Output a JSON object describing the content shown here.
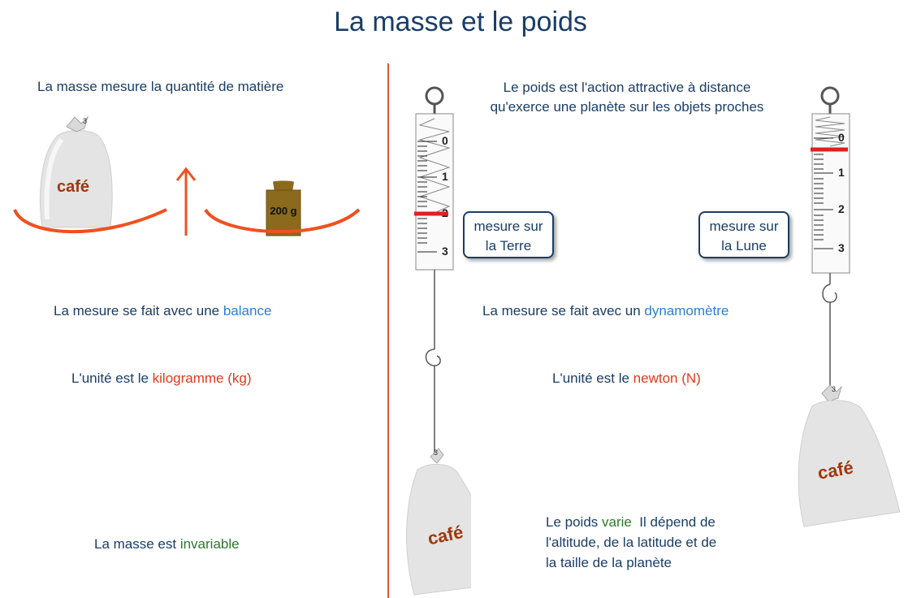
{
  "title": "La masse et le poids",
  "left": {
    "definition": "La masse mesure la quantité de matière",
    "instrument_prefix": "La mesure se fait avec une ",
    "instrument": "balance",
    "unit_prefix": "L'unité est le ",
    "unit": "kilogramme (kg)",
    "invariance_prefix": "La masse est ",
    "invariance": "invariable",
    "bag_label": "café",
    "weight_label": "200 g"
  },
  "right": {
    "definition_line1": "Le poids est l'action attractive à distance",
    "definition_line2": "qu'exerce une planète sur les objets proches",
    "instrument_prefix": "La mesure se fait avec un ",
    "instrument": "dynamomètre",
    "unit_prefix": "L'unité est le ",
    "unit": "newton (N)",
    "varies_prefix": "Le poids ",
    "varies_word": "varie",
    "varies_line1_rest": "  Il dépend de",
    "varies_line2": "l'altitude, de la latitude et de",
    "varies_line3": "la taille de la planète",
    "callout_earth": "mesure sur\nla Terre",
    "callout_moon": "mesure sur\nla Lune",
    "scale_ticks": [
      "0",
      "1",
      "2",
      "3"
    ],
    "bag_label": "café",
    "earth_reading": 2,
    "moon_reading": 0.3
  },
  "colors": {
    "title": "#1a3d66",
    "highlight_blue": "#2b7fd8",
    "highlight_red": "#e03a1a",
    "highlight_green": "#2a7a2a",
    "pan": "#f0501e",
    "arrow": "#f0501e",
    "weight": "#8b6a1e",
    "bag_text": "#a0380e",
    "indicator": "#e02020"
  },
  "icons": [
    "coffee-bag-icon",
    "weight-200g-icon",
    "balance-pan-icon",
    "up-arrow-icon",
    "spring-scale-icon",
    "hook-icon"
  ]
}
